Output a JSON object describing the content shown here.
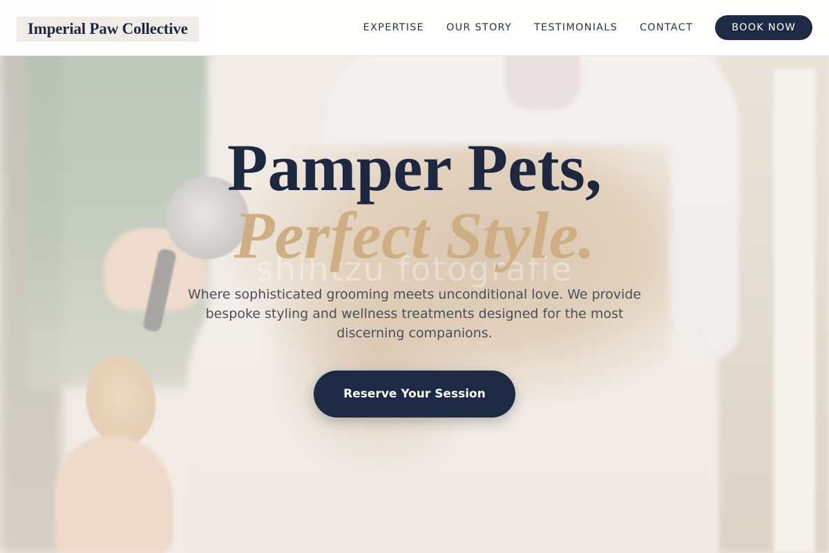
{
  "brand": {
    "name": "Imperial Paw Collective"
  },
  "nav": {
    "links": [
      "EXPERTISE",
      "OUR STORY",
      "TESTIMONIALS",
      "CONTACT"
    ],
    "cta_label": "BOOK NOW"
  },
  "hero": {
    "headline_line1": "Pamper Pets,",
    "headline_line2": "Perfect Style.",
    "watermark": "shihtzu fotografie",
    "subtitle": "Where sophisticated grooming meets unconditional love. We provide bespoke styling and wellness treatments designed for the most discerning companions.",
    "cta_label": "Reserve Your Session"
  },
  "colors": {
    "navy": "#1e2a43",
    "gold": "#cfae84",
    "text_gray": "#4a4e58"
  }
}
